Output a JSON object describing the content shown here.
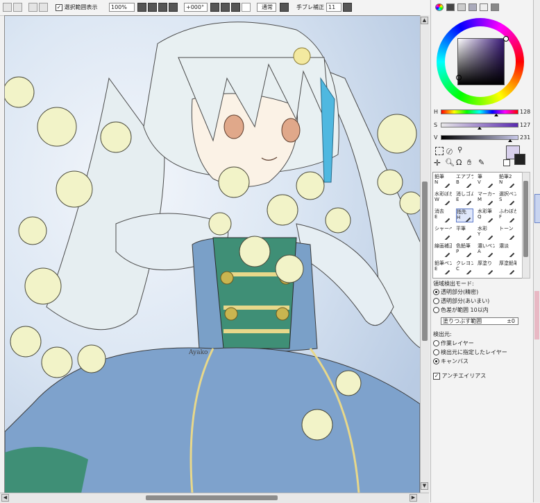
{
  "toolbar": {
    "selection_display_label": "選択範囲表示",
    "selection_display_checked": "✓",
    "zoom_value": "100%",
    "rotation_value": "+000°",
    "blend_mode": "通常",
    "stabilizer_label": "手ブレ補正",
    "stabilizer_value": "11"
  },
  "color": {
    "h_label": "H",
    "s_label": "S",
    "v_label": "V",
    "h_value": "128",
    "s_value": "127",
    "v_value": "231",
    "wheel_ring_color": "#c060ff",
    "square_color": "#3a1a78",
    "h_fraction": 0.72,
    "s_fraction": 0.5,
    "v_fraction": 0.9
  },
  "tools": {
    "items": [
      {
        "label": "鉛筆",
        "key": "N"
      },
      {
        "label": "エアブラシ",
        "key": "B"
      },
      {
        "label": "筆",
        "key": "V"
      },
      {
        "label": "鉛筆2",
        "key": "N"
      },
      {
        "label": "水彩ぼかし",
        "key": "W"
      },
      {
        "label": "消しゴム",
        "key": "E"
      },
      {
        "label": "マーカー",
        "key": "M"
      },
      {
        "label": "選択ペン",
        "key": "S"
      },
      {
        "label": "消去",
        "key": "E"
      },
      {
        "label": "指先",
        "key": "H"
      },
      {
        "label": "水彩筆",
        "key": "Q"
      },
      {
        "label": "ふわぼかし",
        "key": "F"
      },
      {
        "label": "シャーペン",
        "key": ""
      },
      {
        "label": "平筆",
        "key": ""
      },
      {
        "label": "水彩",
        "key": "Y"
      },
      {
        "label": "トーン",
        "key": ""
      },
      {
        "label": "線画補正",
        "key": ""
      },
      {
        "label": "色鉛筆",
        "key": "P"
      },
      {
        "label": "濃いペン",
        "key": "A"
      },
      {
        "label": "濃淡",
        "key": ""
      },
      {
        "label": "鉛筆ペン",
        "key": "E"
      },
      {
        "label": "クレヨン",
        "key": "C"
      },
      {
        "label": "厚塗り",
        "key": ""
      },
      {
        "label": "厚塗鉛筆",
        "key": ""
      }
    ]
  },
  "options": {
    "detect_mode_label": "領域検出モード:",
    "detect_modes": [
      "透明部分(精密)",
      "透明部分(あいまい)",
      "色差が範囲 10以内"
    ],
    "detect_modes_selected": 0,
    "extend_label": "塗りつぶす範囲",
    "extend_value": "±0",
    "source_label": "検出元:",
    "sources": [
      "作業レイヤー",
      "検出元に指定したレイヤー",
      "キャンバス"
    ],
    "sources_selected": 2,
    "antialias_label": "アンチエイリアス",
    "antialias_checked": "✓"
  },
  "canvas": {
    "signature": "Ayako"
  }
}
